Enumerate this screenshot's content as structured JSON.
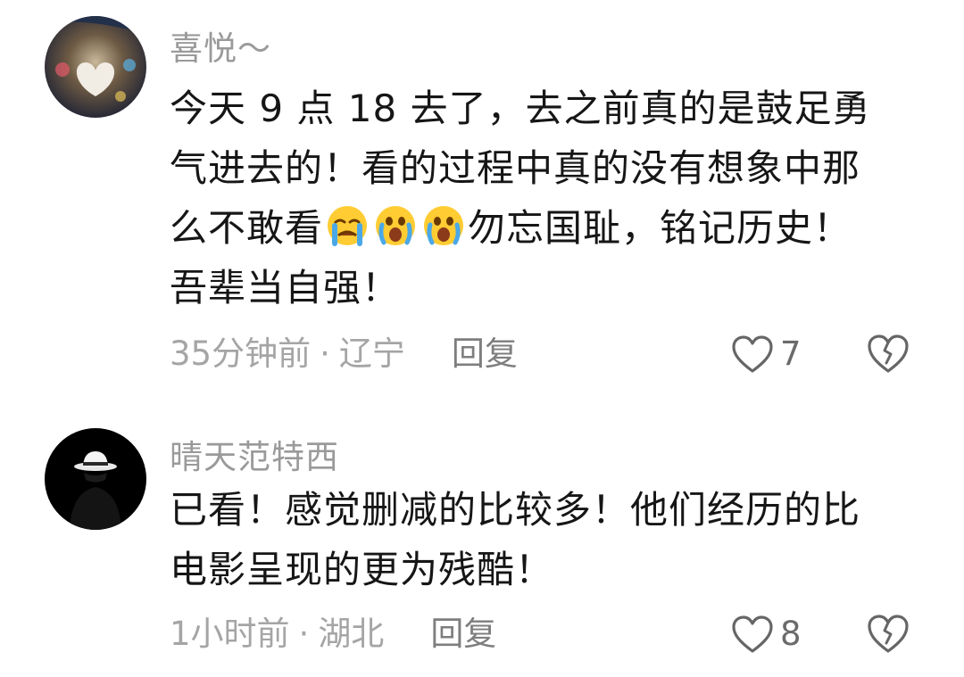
{
  "comments": [
    {
      "username": "喜悦～",
      "lines": [
        "今天 9 点 18 去了，去之前真的是鼓足勇",
        "气进去的！看的过程中真的没有想象中那",
        "么不敢看",
        "勿忘国耻，铭记历史！",
        "吾辈当自强！"
      ],
      "emojis": [
        "loudly-crying-face-icon",
        "screaming-crying-face-icon",
        "screaming-crying-face-icon"
      ],
      "time": "35分钟前",
      "separator": "·",
      "location": "辽宁",
      "reply_label": "回复",
      "like_count": "7"
    },
    {
      "username": "晴天范特西",
      "lines": [
        "已看！感觉删减的比较多！他们经历的比",
        "电影呈现的更为残酷！"
      ],
      "time": "1小时前",
      "separator": "·",
      "location": "湖北",
      "reply_label": "回复",
      "like_count": "8"
    }
  ],
  "colors": {
    "username": "#9a9a9a",
    "text": "#161616",
    "meta": "#a5a5a5",
    "icon": "#666666"
  }
}
